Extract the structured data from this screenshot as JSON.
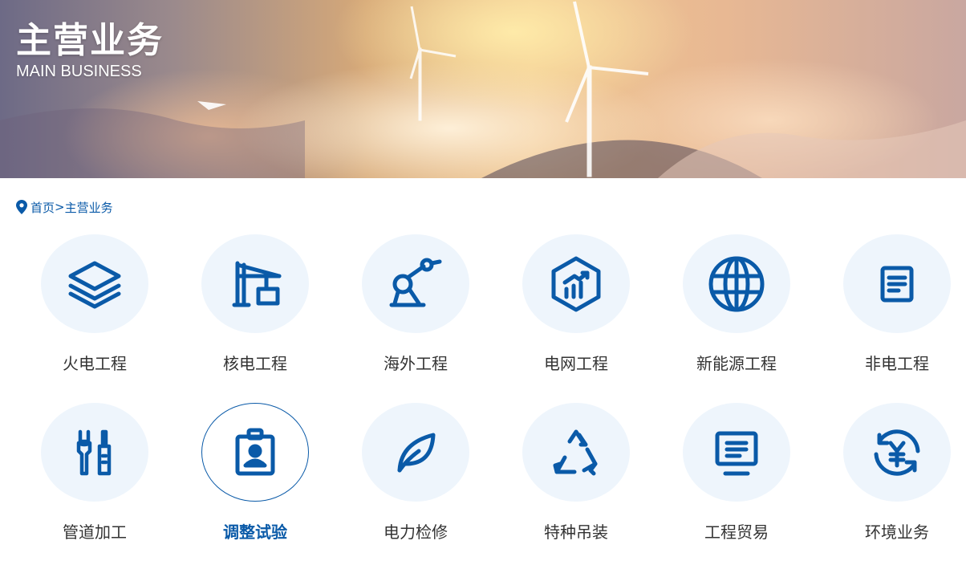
{
  "banner": {
    "title": "主营业务",
    "subtitle": "MAIN BUSINESS"
  },
  "breadcrumb": {
    "icon": "location-pin-icon",
    "home": "首页",
    "separator": ">",
    "current": "主营业务"
  },
  "colors": {
    "accent": "#0a5aa8",
    "circle_bg": "#eef5fc",
    "text": "#333333"
  },
  "business": [
    {
      "label": "火电工程",
      "icon": "layers-icon",
      "active": false
    },
    {
      "label": "核电工程",
      "icon": "crane-icon",
      "active": false
    },
    {
      "label": "海外工程",
      "icon": "robot-arm-icon",
      "active": false
    },
    {
      "label": "电网工程",
      "icon": "hexagon-chart-icon",
      "active": false
    },
    {
      "label": "新能源工程",
      "icon": "globe-icon",
      "active": false
    },
    {
      "label": "非电工程",
      "icon": "document-icon",
      "active": false
    },
    {
      "label": "管道加工",
      "icon": "tools-icon",
      "active": false
    },
    {
      "label": "调整试验",
      "icon": "id-badge-icon",
      "active": true
    },
    {
      "label": "电力检修",
      "icon": "leaf-icon",
      "active": false
    },
    {
      "label": "特种吊装",
      "icon": "recycle-icon",
      "active": false
    },
    {
      "label": "工程贸易",
      "icon": "monitor-icon",
      "active": false
    },
    {
      "label": "环境业务",
      "icon": "yuan-cycle-icon",
      "active": false
    }
  ]
}
